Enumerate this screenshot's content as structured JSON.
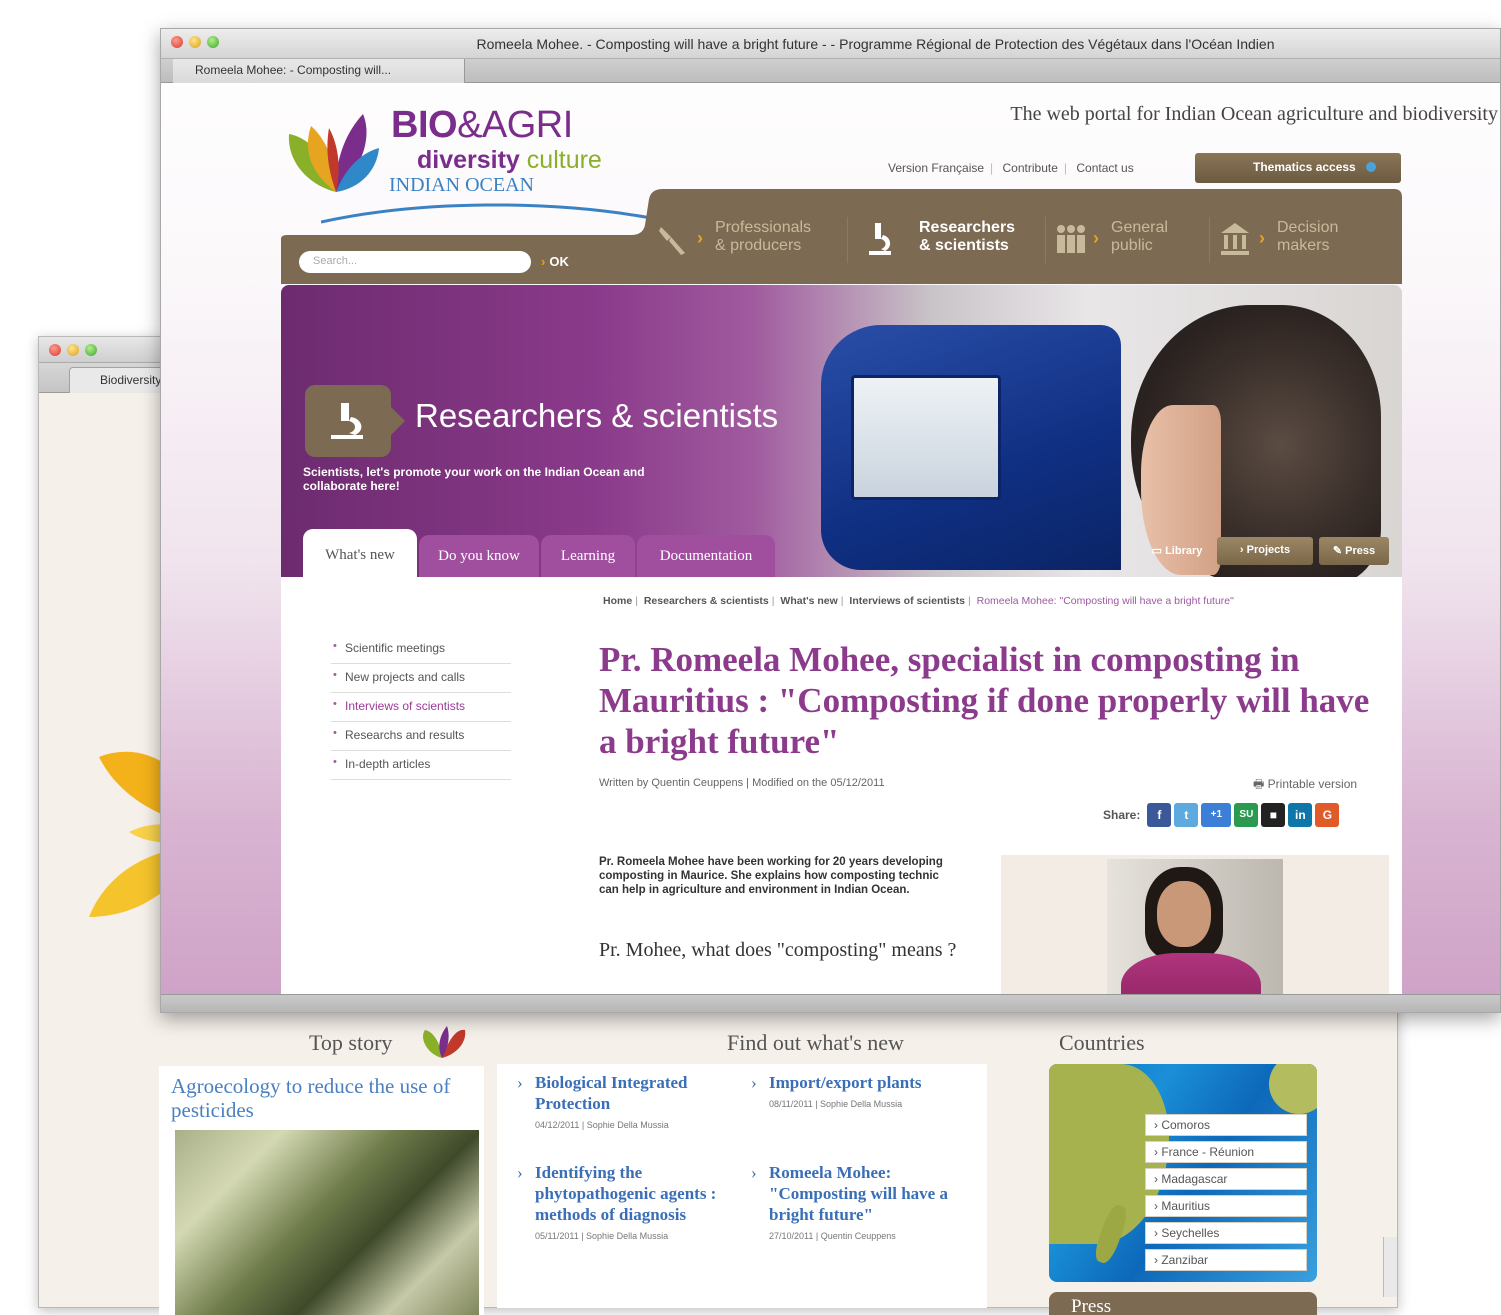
{
  "back_window": {
    "tab_label": "Biodiversity &",
    "top_story": {
      "heading": "Top story",
      "title": "Agroecology to reduce the use of pesticides"
    },
    "find_out": {
      "heading": "Find out what's new",
      "items": [
        {
          "title": "Biological Integrated Protection",
          "meta": "04/12/2011  |  Sophie Della Mussia"
        },
        {
          "title": "Import/export plants",
          "meta": "08/11/2011  |  Sophie Della Mussia"
        },
        {
          "title": "Identifying the phytopathogenic agents : methods of diagnosis",
          "meta": "05/11/2011  |  Sophie Della Mussia"
        },
        {
          "title": "Romeela Mohee: \"Composting will have a bright future\"",
          "meta": "27/10/2011  |  Quentin Ceuppens"
        }
      ]
    },
    "countries": {
      "heading": "Countries",
      "items": [
        "Comoros",
        "France - Réunion",
        "Madagascar",
        "Mauritius",
        "Seychelles",
        "Zanzibar"
      ]
    },
    "press_heading": "Press"
  },
  "front_window": {
    "window_title": "Romeela Mohee. - Composting will have a bright future - - Programme Régional de Protection des Végétaux dans l'Océan Indien",
    "tab_label": "Romeela Mohee: - Composting will...",
    "logo": {
      "bio": "BIO",
      "agri": "&AGRI",
      "diversity": "diversity",
      "culture": "culture",
      "region": "INDIAN OCEAN"
    },
    "tagline": "The web portal for Indian Ocean agriculture and biodiversity",
    "utility_links": [
      "Version Française",
      "Contribute",
      "Contact us"
    ],
    "thematics_label": "Thematics access",
    "search": {
      "placeholder": "Search...",
      "ok": "OK"
    },
    "nav": [
      {
        "line1": "Professionals",
        "line2": "& producers",
        "icon": "tools-icon"
      },
      {
        "line1": "Researchers",
        "line2": "& scientists",
        "icon": "microscope-icon"
      },
      {
        "line1": "General",
        "line2": "public",
        "icon": "people-icon"
      },
      {
        "line1": "Decision",
        "line2": "makers",
        "icon": "government-building-icon"
      }
    ],
    "hero": {
      "title": "Researchers & scientists",
      "subtitle": "Scientists, let's promote your work on the Indian Ocean and collaborate here!"
    },
    "tabs": [
      "What's new",
      "Do you know",
      "Learning",
      "Documentation"
    ],
    "tools": {
      "library": "Library",
      "projects": "Projects",
      "press": "Press"
    },
    "breadcrumb": [
      "Home",
      "Researchers & scientists",
      "What's new",
      "Interviews of scientists"
    ],
    "breadcrumb_current": "Romeela Mohee: \"Composting will have a bright future\"",
    "side_menu": [
      "Scientific meetings",
      "New projects and calls",
      "Interviews of scientists",
      "Researchs and results",
      "In-depth articles"
    ],
    "article": {
      "title": "Pr. Romeela Mohee, specialist in composting in Mauritius : \"Composting if done properly will have a bright future\"",
      "byline": "Written by Quentin Ceuppens  |  Modified on the 05/12/2011",
      "printable": "Printable version",
      "share_label": "Share:",
      "intro": "Pr. Romeela Mohee have been working for 20 years developing composting in Maurice. She explains how composting technic can help in agriculture and environment in Indian Ocean.",
      "question": "Pr. Mohee, what does \"composting\" means ?"
    },
    "share_icons": [
      {
        "name": "facebook-icon",
        "glyph": "f",
        "color": "#3b5998"
      },
      {
        "name": "twitter-icon",
        "glyph": "t",
        "color": "#5ea9dd"
      },
      {
        "name": "google-plus-icon",
        "glyph": "+1",
        "color": "#3d7fd6"
      },
      {
        "name": "stumbleupon-icon",
        "glyph": "SU",
        "color": "#2a9a4f"
      },
      {
        "name": "delicious-icon",
        "glyph": "■",
        "color": "#222222"
      },
      {
        "name": "linkedin-icon",
        "glyph": "in",
        "color": "#0e76a8"
      },
      {
        "name": "orkut-icon",
        "glyph": "G",
        "color": "#e05a2a"
      }
    ],
    "colors": {
      "accent_purple": "#8c3a8c",
      "nav_brown": "#7d6a52",
      "link_blue": "#3a6fb7",
      "orange_arrow": "#e7a420"
    }
  }
}
